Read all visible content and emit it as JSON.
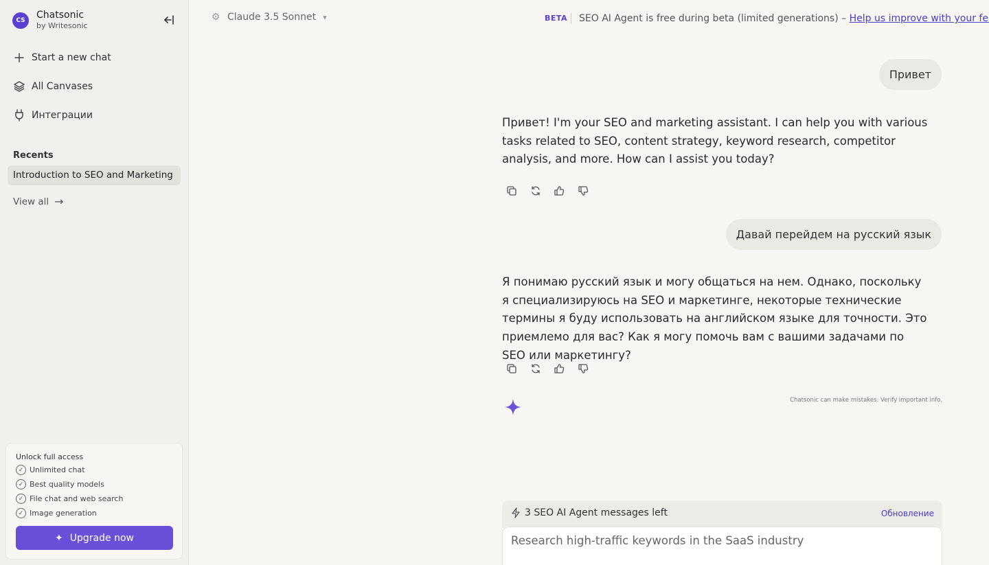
{
  "sidebar": {
    "brand_logo": "CS",
    "brand_name": "Chatsonic",
    "brand_sub": "by Writesonic",
    "nav": [
      {
        "label": "Start a new chat",
        "icon": "plus-icon"
      },
      {
        "label": "All Canvases",
        "icon": "layers-icon"
      },
      {
        "label": "Интеграции",
        "icon": "plug-icon"
      }
    ],
    "recents_label": "Recents",
    "recents": [
      "Introduction to SEO and Marketing"
    ],
    "view_all": "View all",
    "upgrade": {
      "title": "Unlock full access",
      "features": [
        "Unlimited chat",
        "Best quality models",
        "File chat and web search",
        "Image generation"
      ],
      "button": "Upgrade now"
    }
  },
  "topbar": {
    "model": "Claude 3.5 Sonnet",
    "beta_badge": "BETA",
    "beta_text": "SEO AI Agent is free during beta (limited generations) – ",
    "beta_link": "Help us improve with your feedback"
  },
  "chat": {
    "messages": [
      {
        "role": "user",
        "text": "Привет"
      },
      {
        "role": "assistant",
        "text": "Привет! I'm your SEO and marketing assistant. I can help you with various tasks related to SEO, content strategy, keyword research, competitor analysis, and more. How can I assist you today?"
      },
      {
        "role": "user",
        "text": "Давай перейдем на русский язык"
      },
      {
        "role": "assistant",
        "text": "Я понимаю русский язык и могу общаться на нем. Однако, поскольку я специализируюсь на SEO и маркетинге, некоторые технические термины я буду использовать на английском языке для точности. Это приемлемо для вас? Как я могу помочь вам с вашими задачами по SEO или маркетингу?"
      }
    ],
    "disclaimer": "Chatsonic can make mistakes. Verify important info."
  },
  "composer": {
    "quota_text": "3 SEO AI Agent messages left",
    "quota_link": "Обновление",
    "placeholder": "Research high-traffic keywords in the SaaS industry"
  },
  "colors": {
    "accent": "#6a4fd8",
    "link": "#4a3ec8"
  }
}
